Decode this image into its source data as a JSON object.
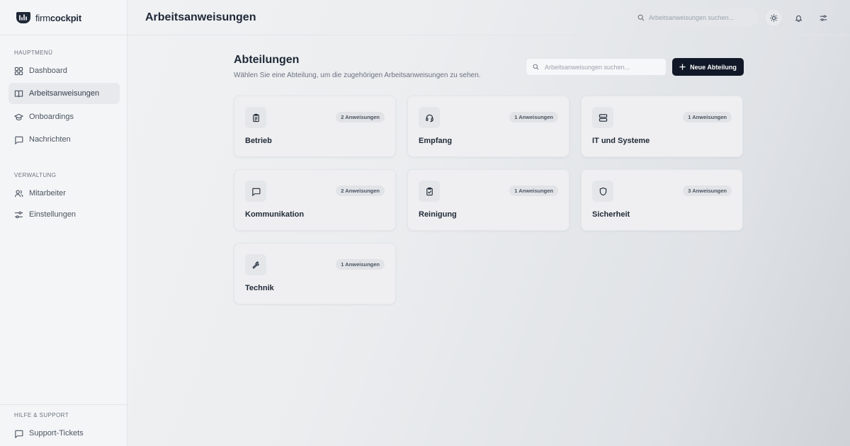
{
  "app": {
    "logo_regular": "firm",
    "logo_bold": "cockpit"
  },
  "sidebar": {
    "main_label": "HAUPTMENÜ",
    "main_items": [
      {
        "label": "Dashboard",
        "icon": "grid-icon"
      },
      {
        "label": "Arbeitsanweisungen",
        "icon": "book-icon",
        "active": true
      },
      {
        "label": "Onboardings",
        "icon": "graduation-cap-icon"
      },
      {
        "label": "Nachrichten",
        "icon": "message-icon"
      }
    ],
    "admin_label": "VERWALTUNG",
    "admin_items": [
      {
        "label": "Mitarbeiter",
        "icon": "users-icon"
      },
      {
        "label": "Einstellungen",
        "icon": "sliders-icon"
      }
    ],
    "support_label": "HILFE & SUPPORT",
    "support_items": [
      {
        "label": "Support-Tickets",
        "icon": "message-icon"
      }
    ]
  },
  "header": {
    "title": "Arbeitsanweisungen",
    "search_placeholder": "Arbeitsanweisungen suchen...",
    "icons": [
      "sun-icon",
      "bell-icon",
      "sliders-icon"
    ]
  },
  "main": {
    "title": "Abteilungen",
    "subtitle": "Wählen Sie eine Abteilung, um die zugehörigen Arbeitsanweisungen zu sehen.",
    "search_placeholder": "Arbeitsanweisungen suchen...",
    "new_button": "Neue Abteilung",
    "departments": [
      {
        "name": "Betrieb",
        "badge": "2 Anweisungen",
        "icon": "clipboard-icon"
      },
      {
        "name": "Empfang",
        "badge": "1 Anweisungen",
        "icon": "headset-icon"
      },
      {
        "name": "IT und Systeme",
        "badge": "1 Anweisungen",
        "icon": "server-icon"
      },
      {
        "name": "Kommunikation",
        "badge": "2 Anweisungen",
        "icon": "message-icon"
      },
      {
        "name": "Reinigung",
        "badge": "1 Anweisungen",
        "icon": "clipboard-check-icon"
      },
      {
        "name": "Sicherheit",
        "badge": "3 Anweisungen",
        "icon": "shield-icon"
      },
      {
        "name": "Technik",
        "badge": "1 Anweisungen",
        "icon": "hammer-icon"
      }
    ]
  },
  "colors": {
    "primary_button": "#111827",
    "text": "#1f2937",
    "muted": "#6b7280"
  }
}
